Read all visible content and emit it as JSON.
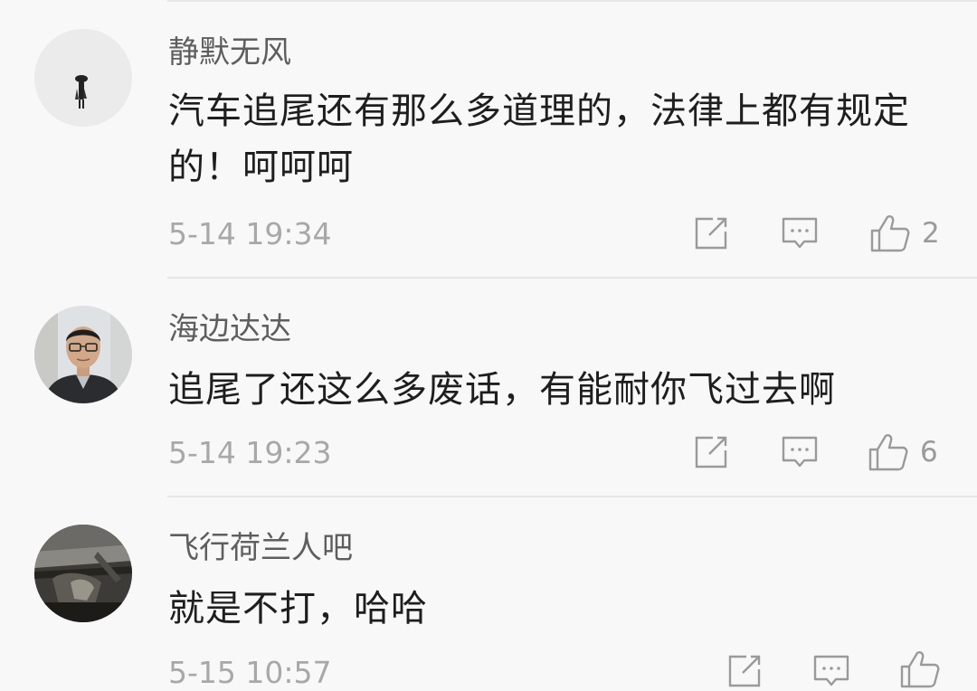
{
  "comments": [
    {
      "username": "静默无风",
      "text": "汽车追尾还有那么多道理的，法律上都有规定的！呵呵呵",
      "time": "5-14 19:34",
      "likes": "2",
      "avatar": "silhouette-figure-avatar"
    },
    {
      "username": "海边达达",
      "text": "追尾了还这么多废话，有能耐你飞过去啊",
      "time": "5-14 19:23",
      "likes": "6",
      "avatar": "man-with-glasses-avatar"
    },
    {
      "username": "飞行荷兰人吧",
      "text": "就是不打，哈哈",
      "time": "5-15 10:57",
      "likes": "",
      "avatar": "dark-photo-avatar"
    }
  ],
  "icons": {
    "share": "share-icon",
    "reply": "reply-icon",
    "like": "thumbs-up-icon"
  },
  "colors": {
    "background": "#f8f8f8",
    "username": "#5e5e5e",
    "text": "#1e1e1e",
    "meta": "#a8a8a8",
    "icon": "#9a9a9a"
  }
}
